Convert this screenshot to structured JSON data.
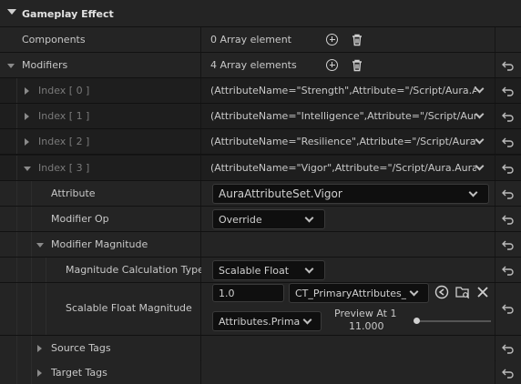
{
  "section": {
    "title": "Gameplay Effect"
  },
  "components": {
    "label": "Components",
    "value": "0 Array element"
  },
  "modifiers": {
    "label": "Modifiers",
    "value": "4 Array elements",
    "items": [
      {
        "label": "Index [ 0 ]",
        "value": "(AttributeName=\"Strength\",Attribute=\"/Script/Aura.Au"
      },
      {
        "label": "Index [ 1 ]",
        "value": "(AttributeName=\"Intelligence\",Attribute=\"/Script/Aura"
      },
      {
        "label": "Index [ 2 ]",
        "value": "(AttributeName=\"Resilience\",Attribute=\"/Script/Aura."
      },
      {
        "label": "Index [ 3 ]",
        "value": "(AttributeName=\"Vigor\",Attribute=\"/Script/Aura.AuraA"
      }
    ]
  },
  "attribute": {
    "label": "Attribute",
    "value": "AuraAttributeSet.Vigor"
  },
  "modifier_op": {
    "label": "Modifier Op",
    "value": "Override"
  },
  "modifier_magnitude": {
    "label": "Modifier Magnitude"
  },
  "magnitude_calc": {
    "label": "Magnitude Calculation Type",
    "value": "Scalable Float"
  },
  "scalable_float": {
    "label": "Scalable Float Magnitude",
    "value": "1.0",
    "curve_table": "CT_PrimaryAttributes_F",
    "row_name": "Attributes.Primar",
    "preview_label": "Preview At 1",
    "preview_value": "11.000",
    "preview_level_fraction": 0.0
  },
  "source_tags": {
    "label": "Source Tags"
  },
  "target_tags": {
    "label": "Target Tags"
  }
}
